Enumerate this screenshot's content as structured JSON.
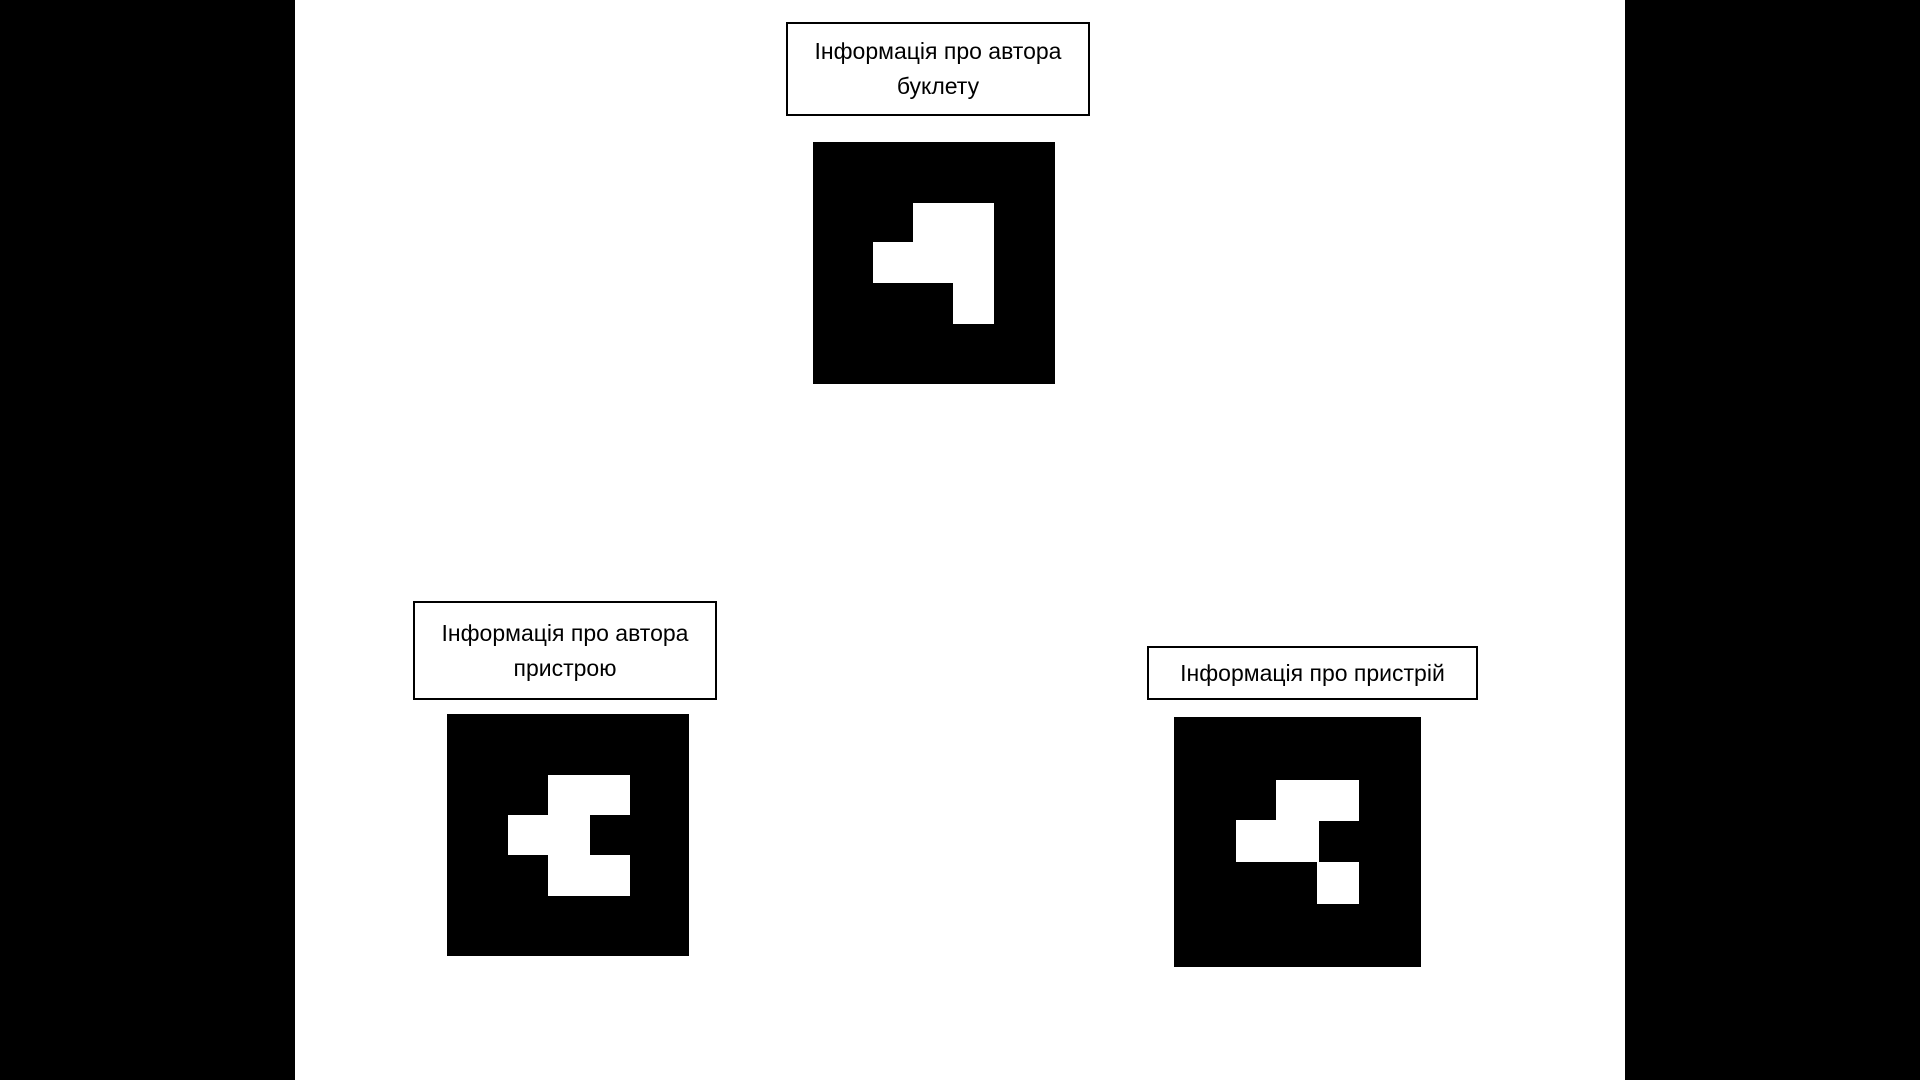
{
  "colors": {
    "background": "#000000",
    "slide": "#ffffff",
    "marker": "#000000",
    "marker_cells": "#ffffff",
    "text": "#000000"
  },
  "labels": {
    "booklet_author": {
      "line1": "Інформація про автора",
      "line2": "буклету"
    },
    "device_author": {
      "line1": "Інформація про автора",
      "line2": "пристрою"
    },
    "device": {
      "line1": "Інформація про пристрій"
    }
  }
}
